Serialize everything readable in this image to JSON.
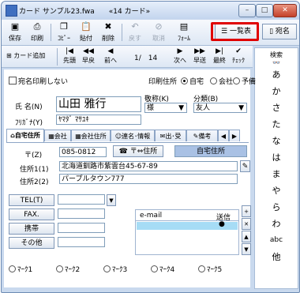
{
  "window": {
    "title": "カード サンプル23.fwa　　«14 カード»",
    "minimize": "–",
    "maximize": "□",
    "close": "✕"
  },
  "toolbar1": {
    "save": "保存",
    "print": "印刷",
    "copy": "ｺﾋﾟｰ",
    "paste": "貼付",
    "delete": "削除",
    "back": "戻す",
    "cancel": "取消",
    "form": "ﾌｫｰﾑ",
    "list": "一覧表",
    "addressee": "宛名"
  },
  "toolbar2": {
    "add_card": "カード追加",
    "first": "先頭",
    "fast_back": "早戻",
    "prev": "前へ",
    "position": "1/　14",
    "next": "次へ",
    "fast_fwd": "早送",
    "last": "最終",
    "check": "ﾁｪｯｸ"
  },
  "kana_index": {
    "label": "検索",
    "items": [
      "あ",
      "か",
      "さ",
      "た",
      "な",
      "は",
      "ま",
      "や",
      "ら",
      "わ",
      "abc",
      "他"
    ]
  },
  "form": {
    "no_print_label": "宛名印刷しない",
    "print_address_label": "印刷住所",
    "print_options": [
      "自宅",
      "会社",
      "予備"
    ],
    "name_label": "氏 名(N)",
    "name_value": "山田 雅行",
    "furigana_label": "ﾌﾘｶﾞﾅ(Y)",
    "furigana_value": "ﾔﾏﾀﾞ ﾏｻﾕｷ",
    "honorific_label": "敬称(K)",
    "honorific_value": "様",
    "category_label": "分類(B)",
    "category_value": "友人"
  },
  "tabs": [
    "自宅住所",
    "会社",
    "会社住所",
    "連名･情報",
    "出･受",
    "備考"
  ],
  "home": {
    "zip_label": "〒(Z)",
    "zip_value": "085-0812",
    "zip_to_addr": "〒⇔住所",
    "home_addr_btn": "自宅住所",
    "addr1_label": "住所1(1)",
    "addr1_value": "北海道釧路市紫雲台45-67-89",
    "addr2_label": "住所2(2)",
    "addr2_value": "パープルタウン777",
    "tel": "TEL(T)",
    "fax": "FAX.",
    "mobile": "携帯",
    "other": "その他",
    "email_header": "e-mail",
    "send_header": "送信"
  },
  "marks": [
    "ﾏｰｸ1",
    "ﾏｰｸ2",
    "ﾏｰｸ3",
    "ﾏｰｸ4",
    "ﾏｰｸ5"
  ]
}
